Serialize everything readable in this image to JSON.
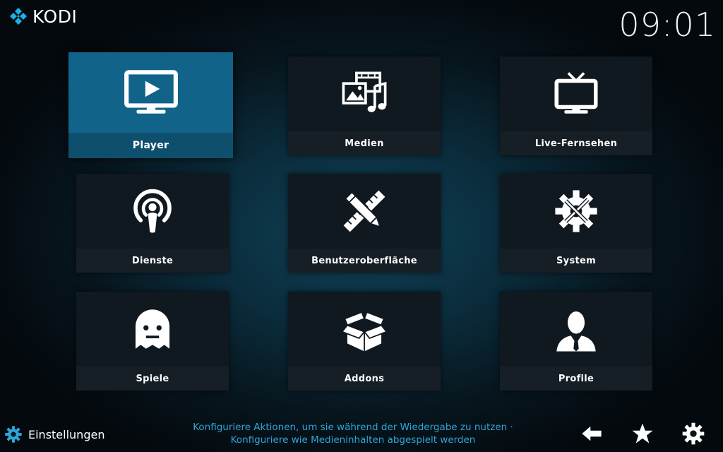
{
  "header": {
    "logo_text": "KODI",
    "clock": "09:01"
  },
  "tiles": [
    {
      "label": "Player",
      "icon": "tv-play-icon"
    },
    {
      "label": "Medien",
      "icon": "media-icon"
    },
    {
      "label": "Live-Fernsehen",
      "icon": "tv-antenna-icon"
    },
    {
      "label": "Dienste",
      "icon": "podcast-icon"
    },
    {
      "label": "Benutzeroberfläche",
      "icon": "pencil-ruler-icon"
    },
    {
      "label": "System",
      "icon": "gear-tools-icon"
    },
    {
      "label": "Spiele",
      "icon": "ghost-icon"
    },
    {
      "label": "Addons",
      "icon": "box-icon"
    },
    {
      "label": "Profile",
      "icon": "user-icon"
    }
  ],
  "footer": {
    "settings_label": "Einstellungen",
    "help_line1": "Konfiguriere Aktionen, um sie während der Wiedergabe zu nutzen ·",
    "help_line2": "Konfiguriere wie Medieninhalten abgespielt werden"
  },
  "colors": {
    "accent": "#2da7d8",
    "focus": "#12638a",
    "tile_bg": "#101820"
  }
}
